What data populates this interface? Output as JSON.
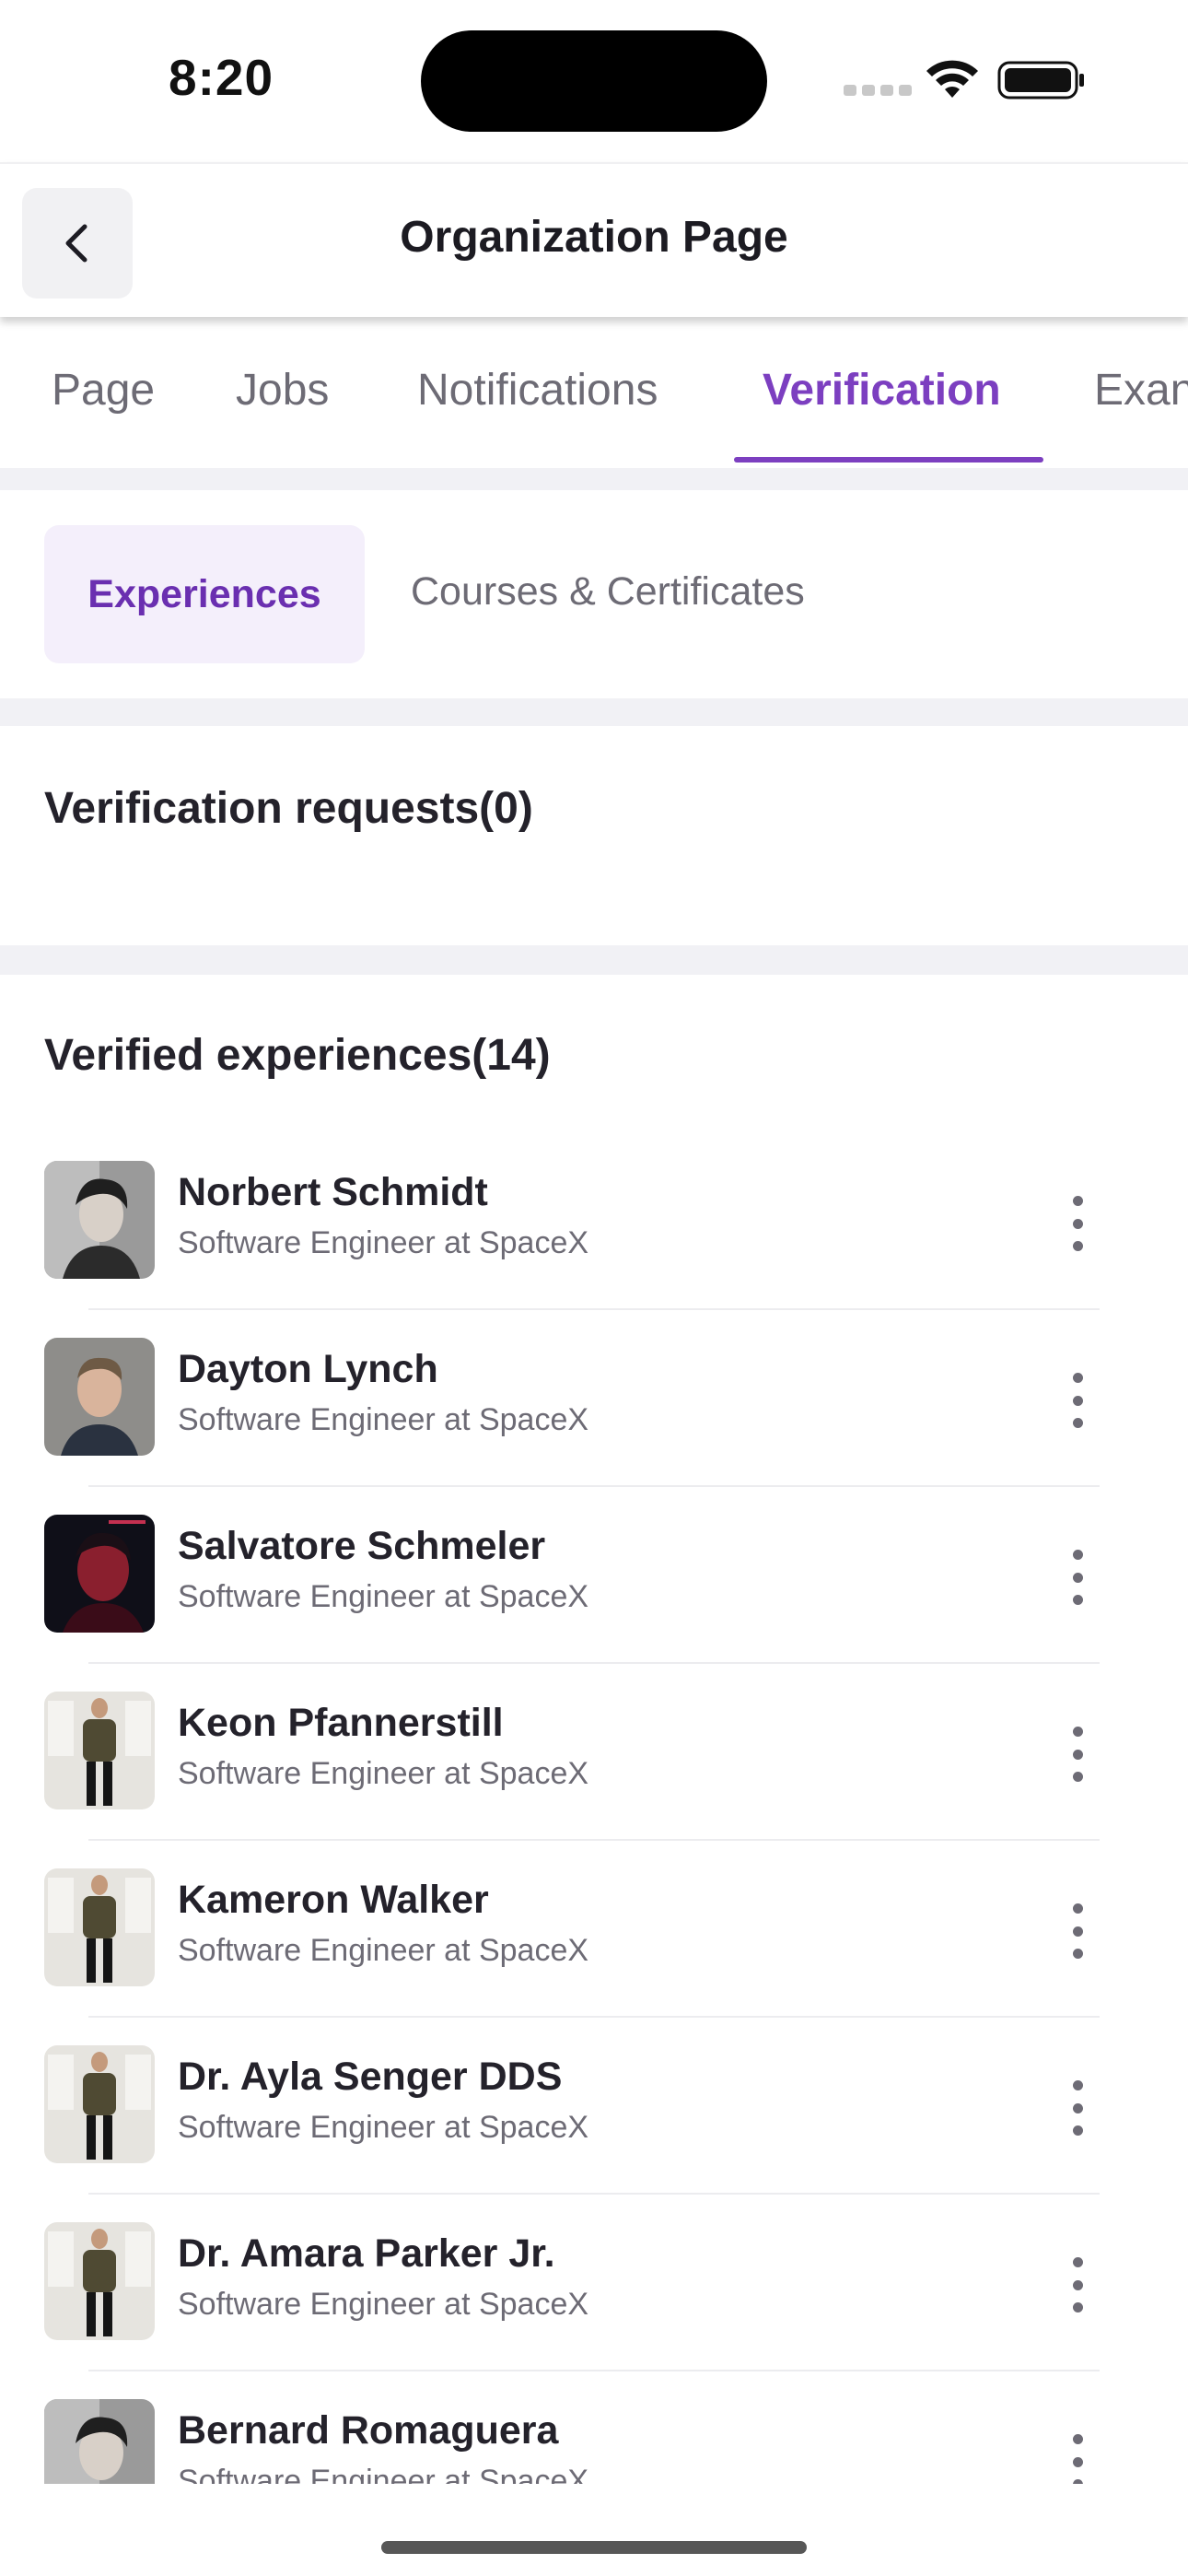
{
  "status_bar": {
    "time": "8:20"
  },
  "header": {
    "title": "Organization Page"
  },
  "tabs": [
    {
      "label": "Page"
    },
    {
      "label": "Jobs"
    },
    {
      "label": "Notifications"
    },
    {
      "label": "Verification"
    },
    {
      "label": "Exan"
    }
  ],
  "subtabs": {
    "experiences": "Experiences",
    "courses": "Courses & Certificates"
  },
  "requests": {
    "title": "Verification requests(0)"
  },
  "verified": {
    "title": "Verified experiences(14)",
    "items": [
      {
        "name": "Norbert Schmidt",
        "role": "Software Engineer at SpaceX"
      },
      {
        "name": "Dayton Lynch",
        "role": "Software Engineer at SpaceX"
      },
      {
        "name": "Salvatore Schmeler",
        "role": "Software Engineer at SpaceX"
      },
      {
        "name": "Keon Pfannerstill",
        "role": "Software Engineer at SpaceX"
      },
      {
        "name": "Kameron Walker",
        "role": "Software Engineer at SpaceX"
      },
      {
        "name": "Dr. Ayla Senger DDS",
        "role": "Software Engineer at SpaceX"
      },
      {
        "name": "Dr. Amara Parker Jr.",
        "role": "Software Engineer at SpaceX"
      },
      {
        "name": "Bernard Romaguera",
        "role": "Software Engineer at SpaceX"
      }
    ]
  },
  "colors": {
    "accent": "#7c3fc0",
    "accent_bg": "#f4effb",
    "text": "#24222b",
    "muted": "#6d6b75"
  }
}
